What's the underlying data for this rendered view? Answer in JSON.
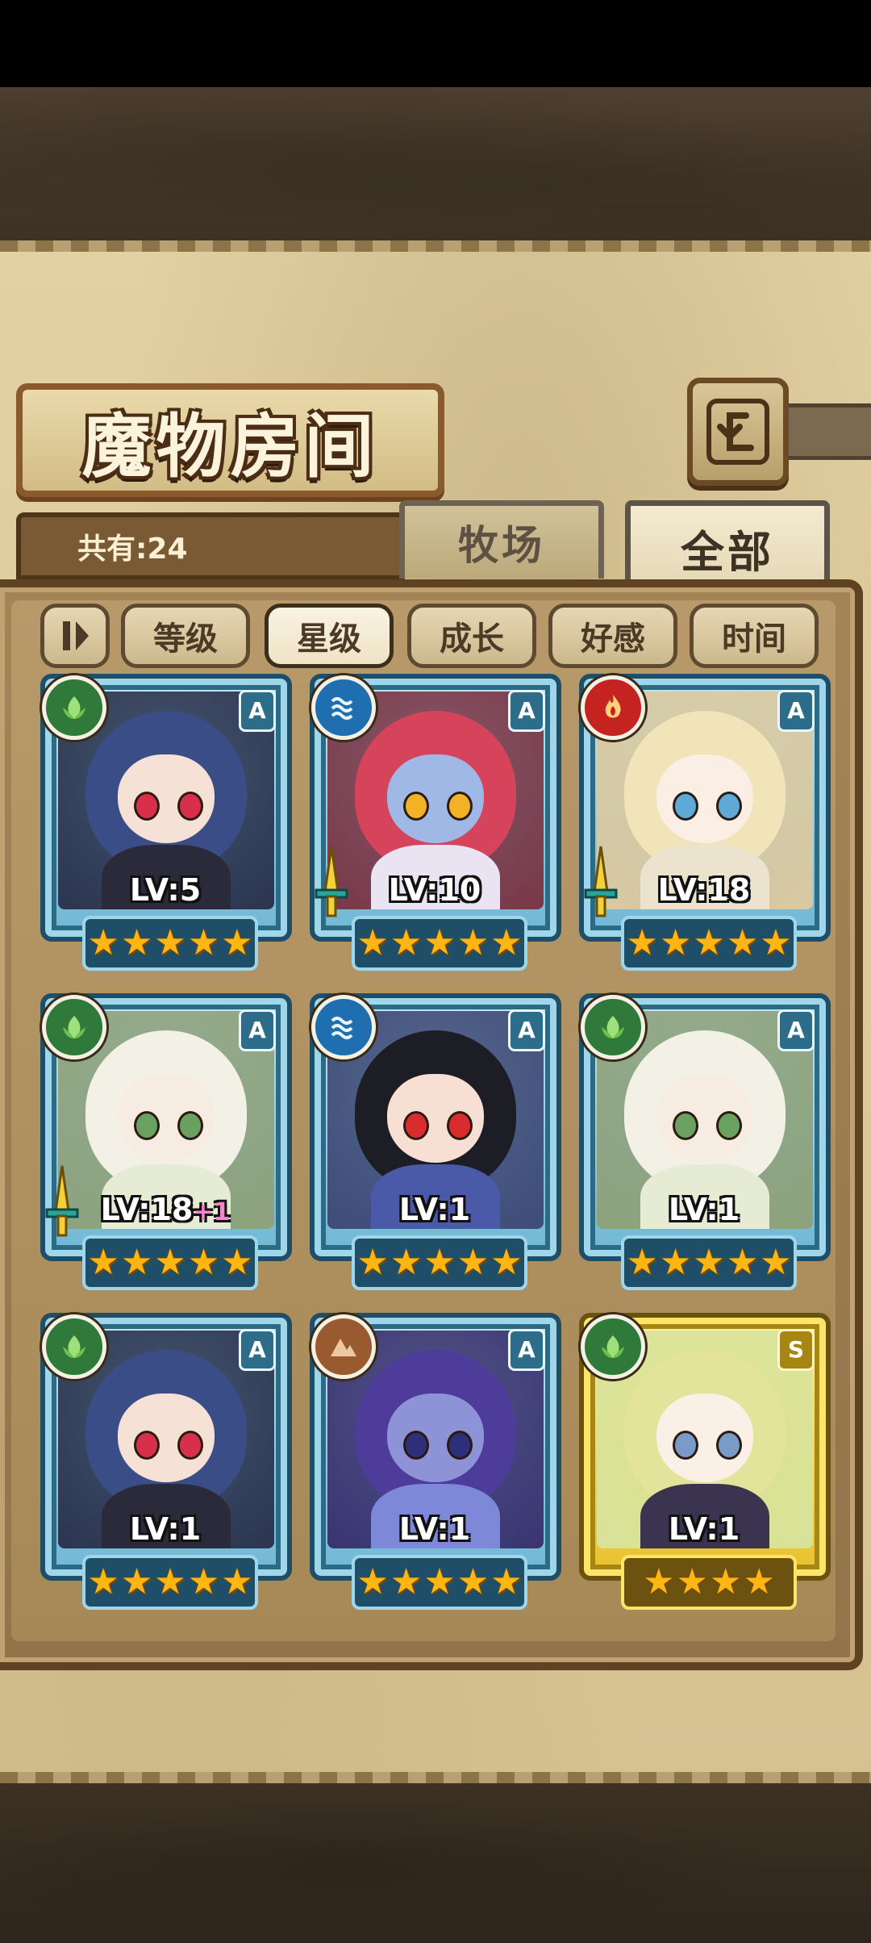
{
  "header": {
    "title": "魔物房间"
  },
  "tabs": {
    "pasture_label": "牧场",
    "all_label": "全部",
    "active": "全部"
  },
  "summary": {
    "count_text": "共有:24"
  },
  "filters": {
    "items": [
      {
        "label": "等级",
        "active": false
      },
      {
        "label": "星级",
        "active": true
      },
      {
        "label": "成长",
        "active": false
      },
      {
        "label": "好感",
        "active": false
      },
      {
        "label": "时间",
        "active": false
      }
    ]
  },
  "cards": [
    {
      "level": "LV:5",
      "bonus": "",
      "element": "grass-icon",
      "rank": "A",
      "stars": 5,
      "weapon": false,
      "frame": "blue"
    },
    {
      "level": "LV:10",
      "bonus": "",
      "element": "water-icon",
      "rank": "A",
      "stars": 5,
      "weapon": true,
      "frame": "blue"
    },
    {
      "level": "LV:18",
      "bonus": "",
      "element": "fire-icon",
      "rank": "A",
      "stars": 5,
      "weapon": true,
      "frame": "blue"
    },
    {
      "level": "LV:18",
      "bonus": "+1",
      "element": "grass-icon",
      "rank": "A",
      "stars": 5,
      "weapon": true,
      "frame": "blue"
    },
    {
      "level": "LV:1",
      "bonus": "",
      "element": "water-icon",
      "rank": "A",
      "stars": 5,
      "weapon": false,
      "frame": "blue"
    },
    {
      "level": "LV:1",
      "bonus": "",
      "element": "grass-icon",
      "rank": "A",
      "stars": 5,
      "weapon": false,
      "frame": "blue"
    },
    {
      "level": "LV:1",
      "bonus": "",
      "element": "grass-icon",
      "rank": "A",
      "stars": 5,
      "weapon": false,
      "frame": "blue"
    },
    {
      "level": "LV:1",
      "bonus": "",
      "element": "earth-icon",
      "rank": "A",
      "stars": 5,
      "weapon": false,
      "frame": "blue"
    },
    {
      "level": "LV:1",
      "bonus": "",
      "element": "grass-icon",
      "rank": "S",
      "stars": 4,
      "weapon": false,
      "frame": "gold"
    }
  ],
  "colors": {
    "accent": "#5e4222",
    "parchment": "#e2d1a3",
    "star": "#ffb512"
  }
}
